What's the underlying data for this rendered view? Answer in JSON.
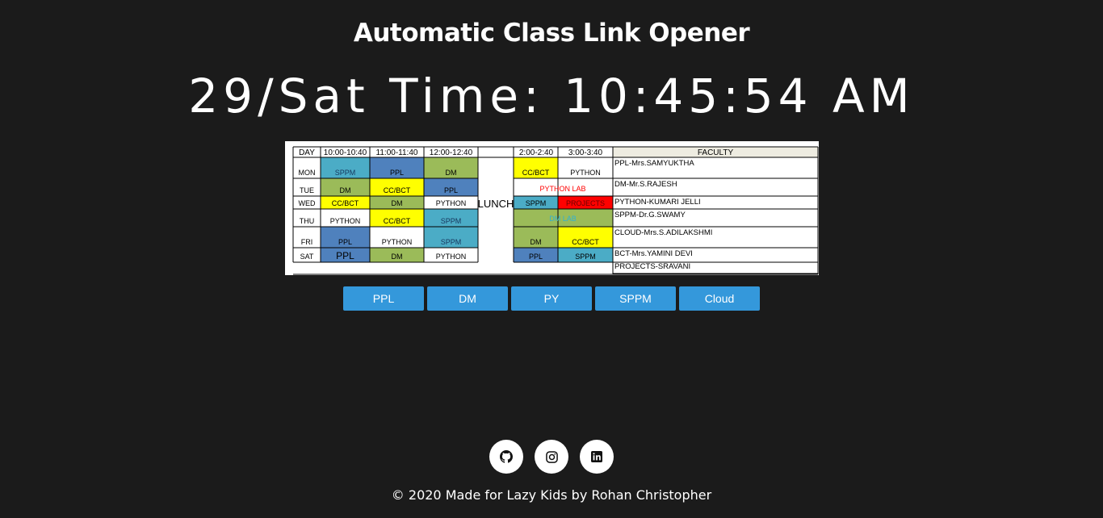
{
  "page": {
    "title": "Automatic Class Link Opener",
    "clock": "29/Sat Time: 10:45:54 AM"
  },
  "timetable": {
    "headers": [
      "DAY",
      "10:00-10:40",
      "11:00-11:40",
      "12:00-12:40",
      "2:00-2:40",
      "3:00-3:40",
      "FACULTY"
    ],
    "lunch": "LUNCH",
    "days": [
      "MON",
      "TUE",
      "WED",
      "THU",
      "FRI",
      "SAT"
    ],
    "rows": [
      [
        "SPPM",
        "PPL",
        "DM",
        "CC/BCT",
        "PYTHON"
      ],
      [
        "DM",
        "CC/BCT",
        "PPL",
        "PYTHON LAB"
      ],
      [
        "CC/BCT",
        "DM",
        "PYTHON",
        "SPPM",
        "PROJECTS"
      ],
      [
        "PYTHON",
        "CC/BCT",
        "SPPM",
        "DM LAB"
      ],
      [
        "PPL",
        "PYTHON",
        "SPPM",
        "DM",
        "CC/BCT"
      ],
      [
        "PPL",
        "DM",
        "PYTHON",
        "PPL",
        "SPPM"
      ]
    ],
    "faculty": [
      "PPL-Mrs.SAMYUKTHA",
      "DM-Mr.S.RAJESH",
      "PYTHON-KUMARI JELLI",
      "SPPM-Dr.G.SWAMY",
      "CLOUD-Mrs.S.ADILAKSHMI",
      "BCT-Mrs.YAMINI DEVI",
      "PROJECTS-SRAVANI"
    ],
    "colors": {
      "teal": "#4bacc6",
      "blue": "#4f81bd",
      "green": "#9bbb59",
      "yellow": "#ffff00",
      "red": "#ff0000",
      "white": "#ffffff"
    }
  },
  "buttons": [
    "PPL",
    "DM",
    "PY",
    "SPPM",
    "Cloud"
  ],
  "socials": [
    {
      "icon": "github-icon"
    },
    {
      "icon": "instagram-icon"
    },
    {
      "icon": "linkedin-icon"
    }
  ],
  "footer": "© 2020 Made for Lazy Kids by Rohan Christopher",
  "theme": {
    "background": "#1b1b1b",
    "button": "#3498db"
  }
}
